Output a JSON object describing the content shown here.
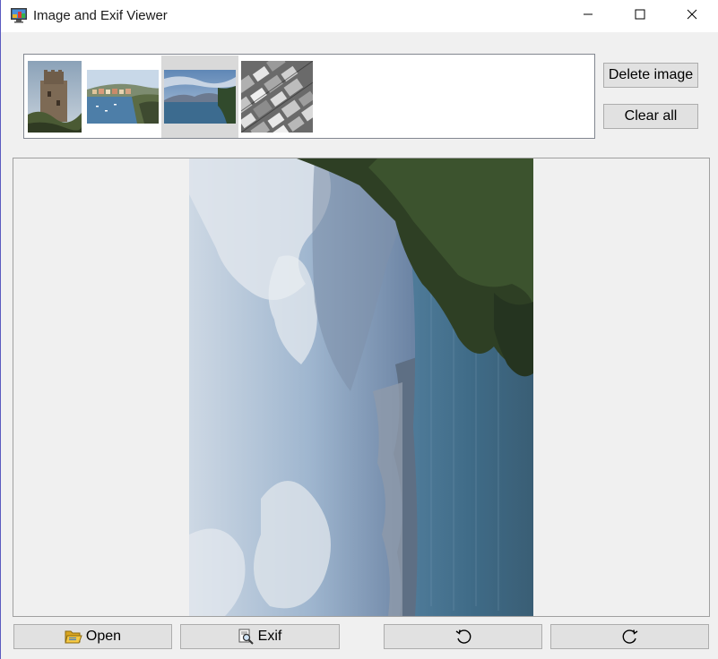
{
  "window": {
    "title": "Image and Exif Viewer",
    "icon": "monitor-app-icon",
    "controls": [
      "minimize-icon",
      "maximize-icon",
      "close-icon"
    ]
  },
  "thumbnails": {
    "items": [
      {
        "name": "castle-tower-photo",
        "selected": false
      },
      {
        "name": "harbor-town-photo",
        "selected": false
      },
      {
        "name": "sea-coast-photo",
        "selected": true
      },
      {
        "name": "aerial-rooftops-bw-photo",
        "selected": false
      }
    ]
  },
  "actions": {
    "delete_label": "Delete image",
    "clear_label": "Clear all"
  },
  "viewer": {
    "image": "sea-coast-photo-rotated",
    "rotation": "90"
  },
  "toolbar": {
    "open_label": "Open",
    "open_icon": "folder-open-icon",
    "exif_label": "Exif",
    "exif_icon": "magnifier-document-icon",
    "rotate_left_icon": "rotate-left-icon",
    "rotate_right_icon": "rotate-right-icon"
  },
  "colors": {
    "window_bg": "#f0f0f0",
    "button_bg": "#e1e1e1",
    "button_border": "#adadad",
    "selection_bg": "#d9d9d9"
  }
}
